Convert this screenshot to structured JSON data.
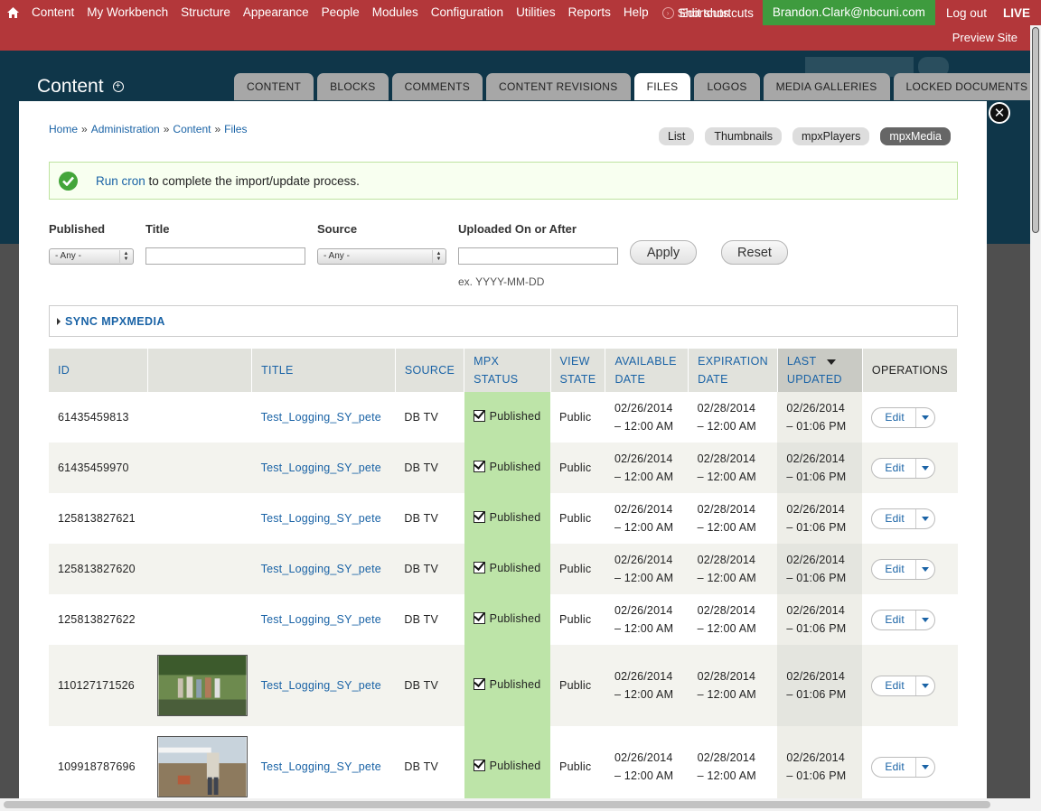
{
  "toolbar": {
    "items": [
      "Content",
      "My Workbench",
      "Structure",
      "Appearance",
      "People",
      "Modules",
      "Configuration",
      "Utilities",
      "Reports",
      "Help"
    ],
    "shortcuts_label": "Shortcuts",
    "edit_shortcuts": "Edit shortcuts",
    "user": "Brandon.Clark@nbcuni.com",
    "logout": "Log out",
    "live": "LIVE",
    "preview": "Preview Site",
    "color": "#b3373a"
  },
  "header": {
    "title": "Content",
    "tabs": [
      "CONTENT",
      "BLOCKS",
      "COMMENTS",
      "CONTENT REVISIONS",
      "FILES",
      "LOGOS",
      "MEDIA GALLERIES",
      "LOCKED DOCUMENTS"
    ],
    "active_tab": "FILES"
  },
  "breadcrumb": [
    "Home",
    "Administration",
    "Content",
    "Files"
  ],
  "view_tabs": [
    "List",
    "Thumbnails",
    "mpxPlayers",
    "mpxMedia"
  ],
  "active_view": "mpxMedia",
  "message": {
    "link": "Run cron",
    "text": " to complete the import/update process."
  },
  "filters": {
    "published_label": "Published",
    "published_value": "- Any -",
    "title_label": "Title",
    "title_value": "",
    "source_label": "Source",
    "source_value": "- Any -",
    "uploaded_label": "Uploaded On or After",
    "uploaded_value": "",
    "uploaded_hint": "ex. YYYY-MM-DD",
    "apply": "Apply",
    "reset": "Reset"
  },
  "sync_legend": "SYNC MPXMEDIA",
  "table": {
    "headers": {
      "id": "ID",
      "title": "TITLE",
      "source": "SOURCE",
      "mpx_status": "MPX STATUS",
      "view_state_1": "VIEW",
      "view_state_2": "STATE",
      "available_1": "AVAILABLE",
      "available_2": "DATE",
      "expiration_1": "EXPIRATION",
      "expiration_2": "DATE",
      "last_updated_1": "LAST",
      "last_updated_2": "UPDATED",
      "operations": "OPERATIONS"
    },
    "rows": [
      {
        "id": "61435459813",
        "title": "Test_Logging_SY_pete",
        "source": "DB TV",
        "status": "Published",
        "view_state": "Public",
        "available_d": "02/26/2014",
        "available_t": "– 12:00 AM",
        "expiration_d": "02/28/2014",
        "expiration_t": "– 12:00 AM",
        "updated_d": "02/26/2014",
        "updated_t": "– 01:06 PM",
        "op": "Edit",
        "thumb": ""
      },
      {
        "id": "61435459970",
        "title": "Test_Logging_SY_pete",
        "source": "DB TV",
        "status": "Published",
        "view_state": "Public",
        "available_d": "02/26/2014",
        "available_t": "– 12:00 AM",
        "expiration_d": "02/28/2014",
        "expiration_t": "– 12:00 AM",
        "updated_d": "02/26/2014",
        "updated_t": "– 01:06 PM",
        "op": "Edit",
        "thumb": ""
      },
      {
        "id": "125813827621",
        "title": "Test_Logging_SY_pete",
        "source": "DB TV",
        "status": "Published",
        "view_state": "Public",
        "available_d": "02/26/2014",
        "available_t": "– 12:00 AM",
        "expiration_d": "02/28/2014",
        "expiration_t": "– 12:00 AM",
        "updated_d": "02/26/2014",
        "updated_t": "– 01:06 PM",
        "op": "Edit",
        "thumb": ""
      },
      {
        "id": "125813827620",
        "title": "Test_Logging_SY_pete",
        "source": "DB TV",
        "status": "Published",
        "view_state": "Public",
        "available_d": "02/26/2014",
        "available_t": "– 12:00 AM",
        "expiration_d": "02/28/2014",
        "expiration_t": "– 12:00 AM",
        "updated_d": "02/26/2014",
        "updated_t": "– 01:06 PM",
        "op": "Edit",
        "thumb": ""
      },
      {
        "id": "125813827622",
        "title": "Test_Logging_SY_pete",
        "source": "DB TV",
        "status": "Published",
        "view_state": "Public",
        "available_d": "02/26/2014",
        "available_t": "– 12:00 AM",
        "expiration_d": "02/28/2014",
        "expiration_t": "– 12:00 AM",
        "updated_d": "02/26/2014",
        "updated_t": "– 01:06 PM",
        "op": "Edit",
        "thumb": ""
      },
      {
        "id": "110127171526",
        "title": "Test_Logging_SY_pete",
        "source": "DB TV",
        "status": "Published",
        "view_state": "Public",
        "available_d": "02/26/2014",
        "available_t": "– 12:00 AM",
        "expiration_d": "02/28/2014",
        "expiration_t": "– 12:00 AM",
        "updated_d": "02/26/2014",
        "updated_t": "– 01:06 PM",
        "op": "Edit",
        "thumb": "group-photo"
      },
      {
        "id": "109918787696",
        "title": "Test_Logging_SY_pete",
        "source": "DB TV",
        "status": "Published",
        "view_state": "Public",
        "available_d": "02/26/2014",
        "available_t": "– 12:00 AM",
        "expiration_d": "02/28/2014",
        "expiration_t": "– 12:00 AM",
        "updated_d": "02/26/2014",
        "updated_t": "– 01:06 PM",
        "op": "Edit",
        "thumb": "field-photo"
      }
    ]
  }
}
